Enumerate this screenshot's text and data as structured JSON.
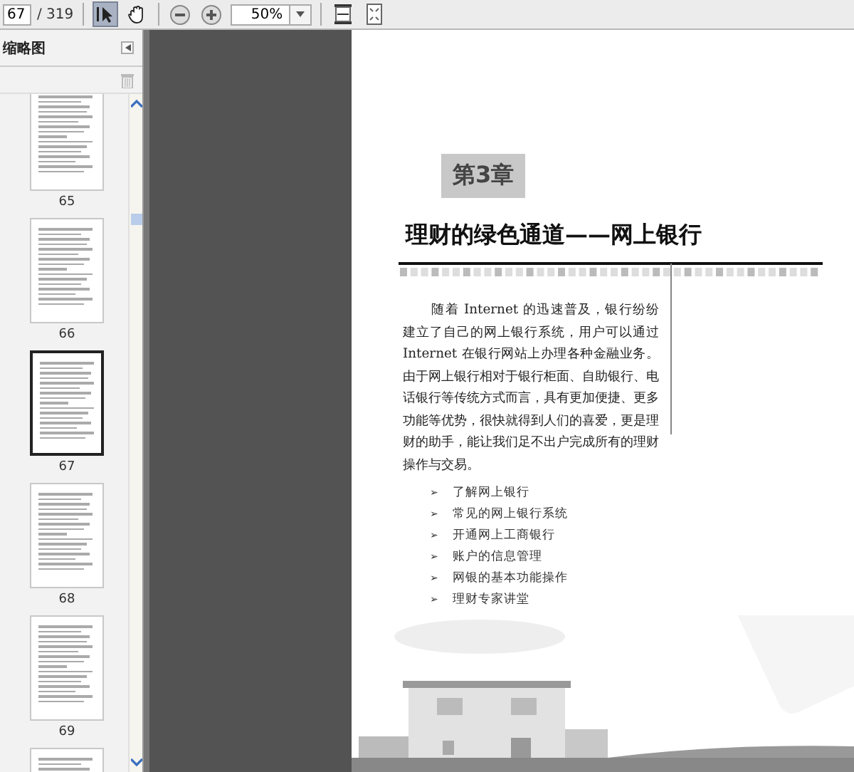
{
  "toolbar": {
    "page_field": {
      "value": "67"
    },
    "page_count": "/ 319",
    "tools": [
      {
        "kind": "select",
        "selected": true
      },
      {
        "kind": "hand",
        "selected": false
      }
    ],
    "zoom_field": {
      "value": "50%"
    }
  },
  "sidebar": {
    "title": "缩略图",
    "thumbnails": [
      {
        "label": "65",
        "selected": false
      },
      {
        "label": "66",
        "selected": false
      },
      {
        "label": "67",
        "selected": true
      },
      {
        "label": "68",
        "selected": false
      },
      {
        "label": "69",
        "selected": false
      },
      {
        "selected": false
      }
    ]
  },
  "page": {
    "chapter": "第3章",
    "title": "理财的绿色通道——网上银行",
    "paragraph": "随着 Internet 的迅速普及，银行纷纷建立了自己的网上银行系统，用户可以通过 Internet 在银行网站上办理各种金融业务。由于网上银行相对于银行柜面、自助银行、电话银行等传统方式而言，具有更加便捷、更多功能等优势，很快就得到人们的喜爱，更是理财的助手，能让我们足不出户完成所有的理财操作与交易。",
    "topics": [
      {
        "marker": "➢",
        "text": "了解网上银行"
      },
      {
        "marker": "➢",
        "text": "常见的网上银行系统"
      },
      {
        "marker": "➢",
        "text": "开通网上工商银行"
      },
      {
        "marker": "➢",
        "text": "账户的信息管理"
      },
      {
        "marker": "➢",
        "text": "网银的基本功能操作"
      },
      {
        "marker": "➢",
        "text": "理财专家讲堂"
      }
    ]
  }
}
